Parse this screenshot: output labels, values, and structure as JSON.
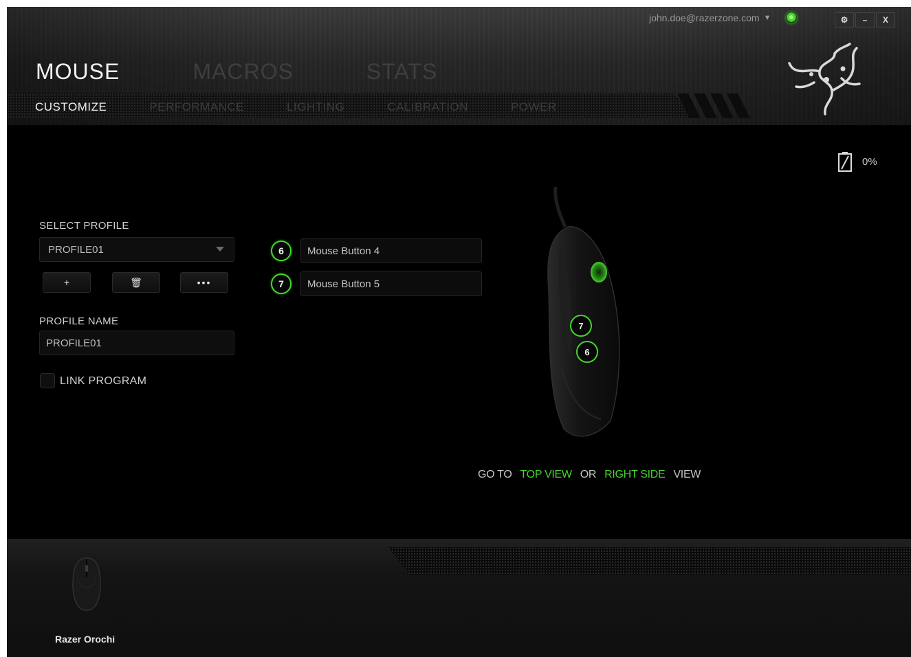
{
  "header": {
    "account": "john.doe@razerzone.com",
    "window_controls": [
      "⚙",
      "–",
      "X"
    ],
    "main_tabs": [
      {
        "label": "MOUSE",
        "active": true
      },
      {
        "label": "MACROS",
        "active": false
      },
      {
        "label": "STATS",
        "active": false
      }
    ],
    "sub_tabs": [
      {
        "label": "CUSTOMIZE",
        "active": true
      },
      {
        "label": "PERFORMANCE",
        "active": false
      },
      {
        "label": "LIGHTING",
        "active": false
      },
      {
        "label": "CALIBRATION",
        "active": false
      },
      {
        "label": "POWER",
        "active": false
      }
    ]
  },
  "battery": {
    "level": "0%",
    "icon": "battery-empty-icon"
  },
  "profile": {
    "select_label": "SELECT PROFILE",
    "selected": "PROFILE01",
    "buttons": {
      "add": "+",
      "delete": "🗑",
      "more": "•••"
    },
    "name_label": "PROFILE NAME",
    "name_value": "PROFILE01",
    "link_program_label": "LINK PROGRAM",
    "link_program_checked": false
  },
  "assignments": [
    {
      "number": "6",
      "action": "Mouse Button 4"
    },
    {
      "number": "7",
      "action": "Mouse Button 5"
    }
  ],
  "view_switch": {
    "goto": "GO TO",
    "top_view": "TOP VIEW",
    "or": "OR",
    "right_side": "RIGHT SIDE",
    "view": "VIEW"
  },
  "device": {
    "name": "Razer Orochi"
  },
  "colors": {
    "accent": "#44d62c",
    "background": "#000000"
  }
}
